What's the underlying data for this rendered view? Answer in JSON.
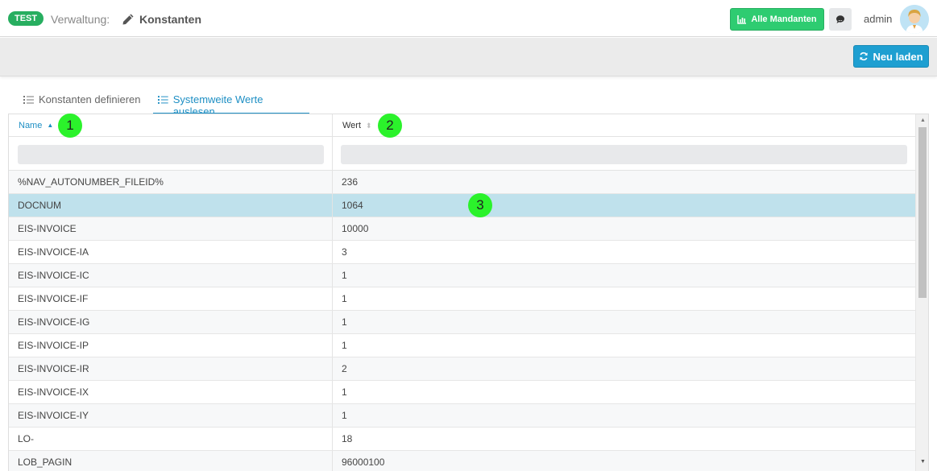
{
  "header": {
    "env_badge": "TEST",
    "breadcrumb_label": "Verwaltung:",
    "page_title": "Konstanten",
    "all_clients_label": "Alle Mandanten",
    "user_name": "admin"
  },
  "toolbar": {
    "reload_label": "Neu laden"
  },
  "tabs": [
    {
      "label": "Konstanten definieren",
      "active": false
    },
    {
      "label": "Systemweite Werte auslesen",
      "active": true
    }
  ],
  "grid": {
    "columns": [
      {
        "label": "Name",
        "sort": "asc"
      },
      {
        "label": "Wert",
        "sort": "none"
      }
    ],
    "filters": {
      "name_value": "",
      "wert_value": ""
    },
    "rows": [
      {
        "name": "%NAV_AUTONUMBER_FILEID%",
        "wert": "236"
      },
      {
        "name": "DOCNUM",
        "wert": "1064"
      },
      {
        "name": "EIS-INVOICE",
        "wert": "10000"
      },
      {
        "name": "EIS-INVOICE-IA",
        "wert": "3"
      },
      {
        "name": "EIS-INVOICE-IC",
        "wert": "1"
      },
      {
        "name": "EIS-INVOICE-IF",
        "wert": "1"
      },
      {
        "name": "EIS-INVOICE-IG",
        "wert": "1"
      },
      {
        "name": "EIS-INVOICE-IP",
        "wert": "1"
      },
      {
        "name": "EIS-INVOICE-IR",
        "wert": "2"
      },
      {
        "name": "EIS-INVOICE-IX",
        "wert": "1"
      },
      {
        "name": "EIS-INVOICE-IY",
        "wert": "1"
      },
      {
        "name": "LO-",
        "wert": "18"
      },
      {
        "name": "LOB_PAGIN",
        "wert": "96000100"
      }
    ],
    "selected_row": "DOCNUM"
  },
  "markers": [
    "1",
    "2",
    "3"
  ],
  "colors": {
    "accent": "#1e8fc4",
    "badge": "#27ae60",
    "all_clients_button": "#2ecc71",
    "reload_button": "#1e9fd1",
    "selected_row": "#bfe1ec",
    "marker": "#2bf22b"
  },
  "icons": {
    "breadcrumb": "pencil-icon",
    "all_clients": "chart-icon",
    "chat": "comment-icon",
    "reload": "refresh-icon",
    "tabs": "list-icon"
  }
}
